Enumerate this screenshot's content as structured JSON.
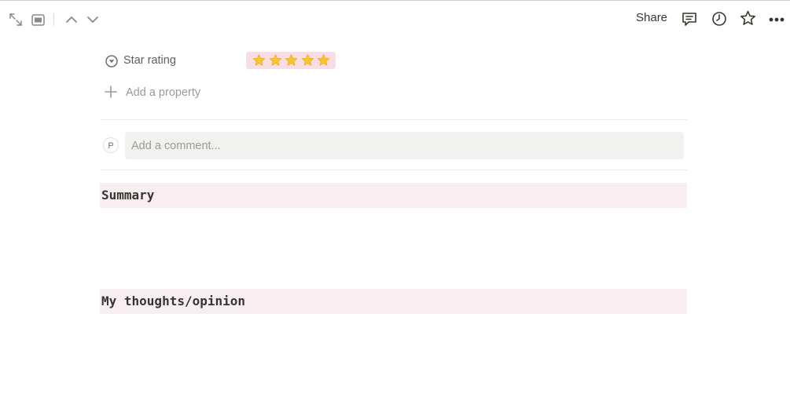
{
  "topbar": {
    "share_label": "Share",
    "icons": [
      "expand-icon",
      "sidebar-peek-icon",
      "chevron-up-icon",
      "chevron-down-icon",
      "comment-icon",
      "history-icon",
      "star-icon",
      "more-icon"
    ]
  },
  "properties": [
    {
      "label": "Star rating",
      "icon": "select-icon",
      "value": 5,
      "max": 5,
      "value_bg": "#f8dde7",
      "star_color": "#f6c530"
    }
  ],
  "add_property_label": "Add a property",
  "comment": {
    "avatar_initial": "P",
    "placeholder": "Add a comment..."
  },
  "sections": [
    {
      "title": "Summary"
    },
    {
      "title": "My thoughts/opinion"
    }
  ],
  "colors": {
    "heading_bg": "#f8eef2",
    "text": "#37352f",
    "muted": "#9b9a97"
  }
}
